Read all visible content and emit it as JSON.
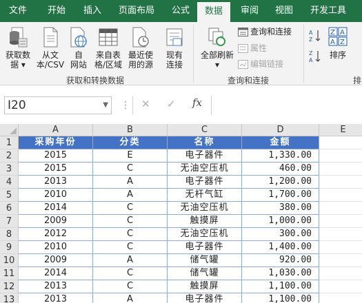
{
  "tabs": [
    "文件",
    "开始",
    "插入",
    "页面布局",
    "公式",
    "数据",
    "审阅",
    "视图",
    "开发工具"
  ],
  "active_tab": "数据",
  "ribbon": {
    "get_data_label": "获取数\n据 ▾",
    "from_text_label": "从文\n本/CSV",
    "from_web_label": "自\n网站",
    "from_table_label": "来自表\n格/区域",
    "recent_sources_label": "最近使\n用的源",
    "existing_conn_label": "现有\n连接",
    "group1_label": "获取和转换数据",
    "refresh_all_label": "全部刷新\n▾",
    "queries_conn_label": "查询和连接",
    "properties_label": "属性",
    "edit_links_label": "编辑链接",
    "group2_label": "查询和连接",
    "sort_label": "排序",
    "group3_label_partial": "排"
  },
  "formula_bar": {
    "name_box": "I20",
    "cancel_icon": "✕",
    "enter_icon": "✓",
    "fx_label": "fx",
    "formula": ""
  },
  "sheet": {
    "columns": [
      "A",
      "B",
      "C",
      "D",
      "E"
    ],
    "rows": [
      "1",
      "2",
      "3",
      "4",
      "5",
      "6",
      "7",
      "8",
      "9",
      "10",
      "11",
      "12",
      "13"
    ],
    "header": [
      "采购年份",
      "分类",
      "名称",
      "金额"
    ],
    "data": [
      [
        "2015",
        "E",
        "电子器件",
        "1,330.00"
      ],
      [
        "2015",
        "C",
        "无油空压机",
        "460.00"
      ],
      [
        "2013",
        "A",
        "电子器件",
        "1,200.00"
      ],
      [
        "2010",
        "A",
        "无杆气缸",
        "1,700.00"
      ],
      [
        "2014",
        "C",
        "无油空压机",
        "380.00"
      ],
      [
        "2009",
        "C",
        "触摸屏",
        "1,000.00"
      ],
      [
        "2012",
        "C",
        "无油空压机",
        "300.00"
      ],
      [
        "2010",
        "C",
        "电子器件",
        "1,400.00"
      ],
      [
        "2009",
        "A",
        "储气罐",
        "920.00"
      ],
      [
        "2014",
        "C",
        "储气罐",
        "1,030.00"
      ],
      [
        "2013",
        "C",
        "触摸屏",
        "1,100.00"
      ],
      [
        "2013",
        "A",
        "电子器件",
        "1,100.00"
      ]
    ]
  },
  "colors": {
    "ribbon_green": "#217346",
    "header_blue": "#4472c4",
    "border_blue": "#8ea9db"
  }
}
